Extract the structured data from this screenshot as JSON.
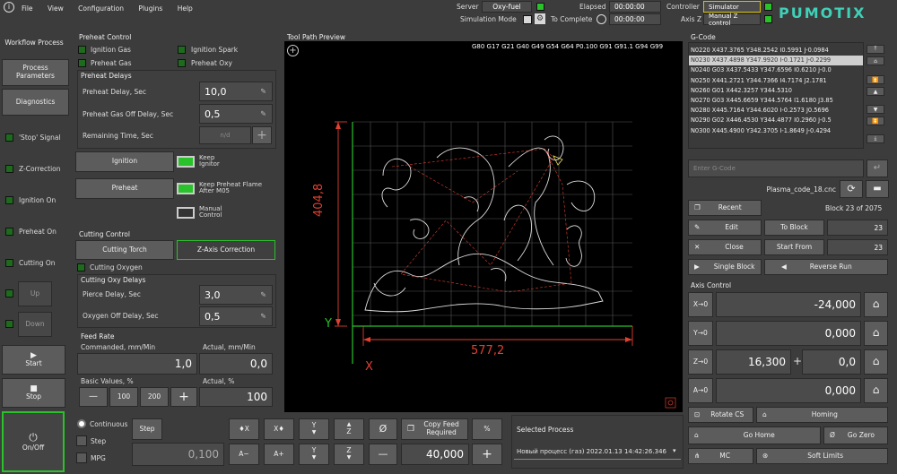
{
  "menu": {
    "items": [
      "File",
      "View",
      "Configuration",
      "Plugins",
      "Help"
    ]
  },
  "header": {
    "server_label": "Server",
    "server_value": "Oxy-fuel",
    "sim_label": "Simulation Mode",
    "elapsed_label": "Elapsed",
    "elapsed_value": "00:00:00",
    "complete_label": "To Complete",
    "complete_value": "00:00:00",
    "controller_label": "Controller",
    "controller_value": "Simulator",
    "axisz_label": "Axis Z",
    "axisz_value": "Manual Z control",
    "logo": "PUMOTIX"
  },
  "sidebar": {
    "tabs": [
      "Workflow Process",
      "Process Parameters",
      "Diagnostics"
    ],
    "signals": [
      "'Stop' Signal",
      "Z-Correction",
      "Ignition On",
      "Preheat On",
      "Cutting On"
    ],
    "up": "Up",
    "down": "Down",
    "start": "Start",
    "stop": "Stop",
    "onoff": "On/Off"
  },
  "preheat": {
    "title": "Preheat Control",
    "checks": [
      "Ignition Gas",
      "Ignition Spark",
      "Preheat Gas",
      "Preheat Oxy"
    ],
    "delays_title": "Preheat Delays",
    "delay_label": "Preheat Delay, Sec",
    "delay_value": "10,0",
    "gasoff_label": "Preheat Gas Off Delay, Sec",
    "gasoff_value": "0,5",
    "remaining_label": "Remaining Time, Sec",
    "remaining_value": "n/d",
    "ignition_btn": "Ignition",
    "keep_ignitor": "Keep Ignitor",
    "preheat_btn": "Preheat",
    "keep_flame": "Keep Preheat Flame After M05",
    "manual": "Manual Control"
  },
  "cutting": {
    "title": "Cutting Control",
    "torch_btn": "Cutting Torch",
    "zaxis_btn": "Z-Axis Correction",
    "oxygen": "Cutting Oxygen",
    "delays_title": "Cutting Oxy Delays",
    "pierce_label": "Pierce Delay, Sec",
    "pierce_value": "3,0",
    "oxyoff_label": "Oxygen Off Delay, Sec",
    "oxyoff_value": "0,5"
  },
  "feed": {
    "title": "Feed Rate",
    "commanded_label": "Commanded, mm/Min",
    "actual_label": "Actual, mm/Min",
    "commanded_value": "1,0",
    "actual_value": "0,0",
    "basic_label": "Basic Values, %",
    "actual_pct_label": "Actual, %",
    "btn_minus": "—",
    "btn_100": "100",
    "btn_200": "200",
    "btn_plus": "+",
    "actual_pct_value": "100"
  },
  "toolpath": {
    "title": "Tool Path Preview",
    "modal": "G80 G17 G21 G40 G49 G54 G64 P0.100 G91 G91.1 G94 G99",
    "dim_h": "577,2",
    "dim_v": "404,8",
    "axis_x": "X",
    "axis_y": "Y"
  },
  "jog": {
    "continuous": "Continuous",
    "step": "Step",
    "mpg": "MPG",
    "step_btn": "Step",
    "step_value": "0,100",
    "btns": [
      "♦X",
      "X♦",
      "Y",
      "Z",
      "Ø",
      "A−",
      "A+",
      "Y",
      "Z",
      "—"
    ],
    "copy_feed": "Copy Feed Required",
    "pct": "%",
    "value": "40,000",
    "plus": "+"
  },
  "selected": {
    "title": "Selected Process",
    "value": "Новый процесс (газ) 2022.01.13 14:42:26.346"
  },
  "gcode": {
    "title": "G-Code",
    "lines": [
      "N0220 X437.3765 Y348.2542 I0.5991 J-0.0984",
      "N0230 X437.4898 Y347.9920 I-0.1721 J-0.2299",
      "N0240 G03 X437.5433 Y347.6596 I0.6210 J-0.0",
      "N0250 X441.2721 Y344.7366 I4.7174 J2.1781",
      "N0260 G01 X442.3257 Y344.5310",
      "N0270 G03 X445.6659 Y344.5764 I1.6180 J3.85",
      "N0280 X445.7164 Y344.6020 I-0.2573 J0.5696",
      "N0290 G02 X446.4530 Y344.4877 I0.2960 J-0.5",
      "N0300 X445.4900 Y342.3705 I-1.8649 J-0.4294"
    ],
    "input_placeholder": "Enter G-Code",
    "filename": "Plasma_code_18.cnc",
    "recent": "Recent",
    "block": "Block 23 of 2075",
    "edit": "Edit",
    "to_block": "To Block",
    "to_block_value": "23",
    "close": "Close",
    "start_from": "Start From",
    "start_from_value": "23",
    "single": "Single Block",
    "reverse": "Reverse Run"
  },
  "axis": {
    "title": "Axis Control",
    "x_btn": "X→0",
    "x_value": "-24,000",
    "y_btn": "Y→0",
    "y_value": "0,000",
    "z_btn": "Z→0",
    "z_value": "16,300",
    "z_off": "0,0",
    "a_btn": "A→0",
    "a_value": "0,000",
    "rotate": "Rotate CS",
    "homing": "Homing",
    "gohome": "Go Home",
    "gozero": "Go Zero",
    "mc": "MC",
    "soft": "Soft Limits"
  }
}
